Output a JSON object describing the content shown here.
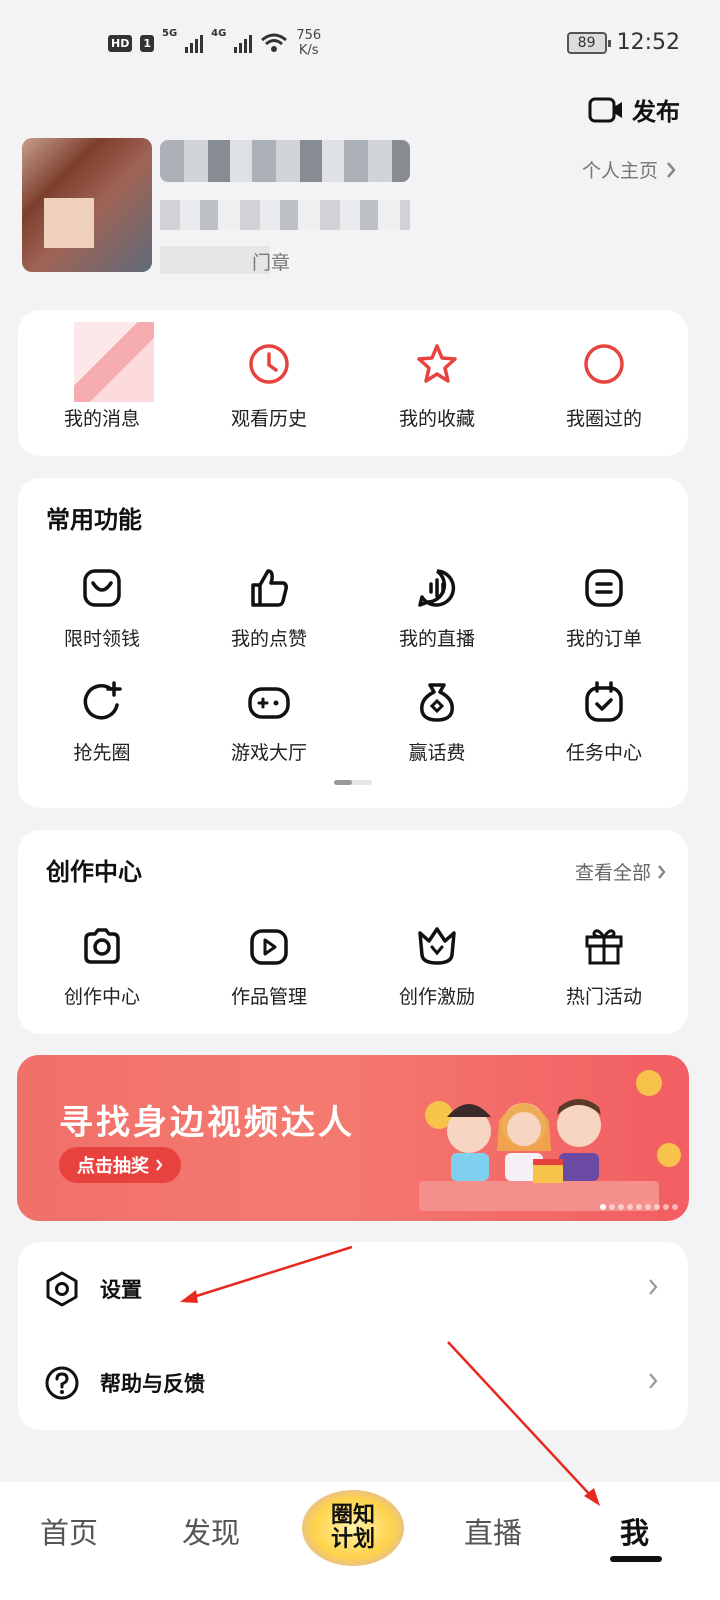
{
  "status_bar": {
    "hd": "HD",
    "sim": "1",
    "net1": "5G",
    "net2": "4G",
    "speed_value": "756",
    "speed_unit": "K/s",
    "battery": "89",
    "time": "12:52"
  },
  "header": {
    "publish_label": "发布"
  },
  "profile": {
    "tail_text": "门章",
    "home_link": "个人主页"
  },
  "quick_actions": [
    {
      "label": "我的消息",
      "icon": "message-icon"
    },
    {
      "label": "观看历史",
      "icon": "clock-icon"
    },
    {
      "label": "我的收藏",
      "icon": "star-icon"
    },
    {
      "label": "我圈过的",
      "icon": "circle-icon"
    }
  ],
  "common": {
    "title": "常用功能",
    "items": [
      {
        "label": "限时领钱",
        "icon": "coin-bag-icon"
      },
      {
        "label": "我的点赞",
        "icon": "thumbs-up-icon"
      },
      {
        "label": "我的直播",
        "icon": "live-icon"
      },
      {
        "label": "我的订单",
        "icon": "order-icon"
      },
      {
        "label": "抢先圈",
        "icon": "circle-plus-icon"
      },
      {
        "label": "游戏大厅",
        "icon": "gamepad-icon"
      },
      {
        "label": "赢话费",
        "icon": "money-bag-icon"
      },
      {
        "label": "任务中心",
        "icon": "task-icon"
      }
    ]
  },
  "create": {
    "title": "创作中心",
    "view_all": "查看全部",
    "items": [
      {
        "label": "创作中心",
        "icon": "camera-icon"
      },
      {
        "label": "作品管理",
        "icon": "video-icon"
      },
      {
        "label": "创作激励",
        "icon": "crown-icon"
      },
      {
        "label": "热门活动",
        "icon": "gift-icon"
      }
    ]
  },
  "banner": {
    "title": "寻找身边视频达人",
    "button": "点击抽奖"
  },
  "menu": [
    {
      "label": "设置",
      "icon": "settings-icon"
    },
    {
      "label": "帮助与反馈",
      "icon": "help-icon"
    }
  ],
  "nav": {
    "home": "首页",
    "discover": "发现",
    "center_line1": "圈知",
    "center_line2": "计划",
    "live": "直播",
    "me": "我"
  },
  "colors": {
    "accent": "#e8423f",
    "banner": "#f0706a"
  }
}
